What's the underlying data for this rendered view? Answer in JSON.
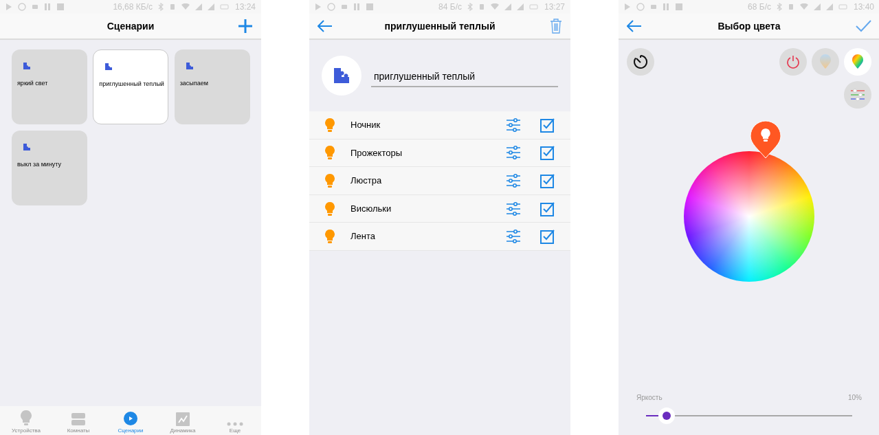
{
  "scenes_screen": {
    "status_bar": {
      "speed": "16,68 КБ/с",
      "time": "13:24"
    },
    "title": "Сценарии",
    "scenes": [
      {
        "label": "яркий свет",
        "selected": false
      },
      {
        "label": "приглушенный теплый",
        "selected": true
      },
      {
        "label": "засыпаем",
        "selected": false
      },
      {
        "label": "выкл за минуту",
        "selected": false
      }
    ],
    "nav": [
      {
        "kind": "bulb",
        "label": "Устройства",
        "selected": false
      },
      {
        "kind": "rooms",
        "label": "Комнаты",
        "selected": false
      },
      {
        "kind": "play",
        "label": "Сценарии",
        "selected": true
      },
      {
        "kind": "chart",
        "label": "Динамика",
        "selected": false
      },
      {
        "kind": "more",
        "label": "Еще",
        "selected": false
      }
    ]
  },
  "scene_editor": {
    "status_bar": {
      "speed": "84 Б/с",
      "time": "13:27"
    },
    "title": "приглушенный теплый",
    "name_field": {
      "value": "приглушенный теплый"
    },
    "devices": [
      {
        "name": "Ночник",
        "checked": true
      },
      {
        "name": "Прожекторы",
        "checked": true
      },
      {
        "name": "Люстра",
        "checked": true
      },
      {
        "name": "Висюльки",
        "checked": true
      },
      {
        "name": "Лента",
        "checked": true
      }
    ]
  },
  "color_picker": {
    "status_bar": {
      "speed": "68 Б/с",
      "time": "13:40"
    },
    "title": "Выбор цвета",
    "modes": [
      {
        "kind": "power",
        "selected": false
      },
      {
        "kind": "white",
        "selected": false
      },
      {
        "kind": "color",
        "selected": true
      }
    ],
    "brightness": {
      "label": "Яркость",
      "reading": "10%",
      "level": 0.1
    }
  }
}
